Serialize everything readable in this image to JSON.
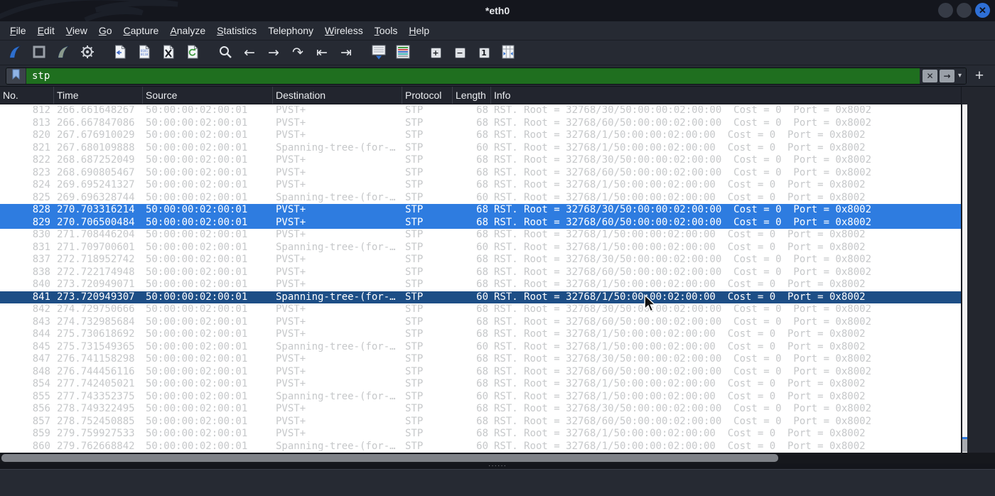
{
  "window": {
    "title": "*eth0"
  },
  "menu_bar": {
    "items": [
      {
        "label": "File",
        "mnemonic": 0
      },
      {
        "label": "Edit",
        "mnemonic": 0
      },
      {
        "label": "View",
        "mnemonic": 0
      },
      {
        "label": "Go",
        "mnemonic": 0
      },
      {
        "label": "Capture",
        "mnemonic": 0
      },
      {
        "label": "Analyze",
        "mnemonic": 0
      },
      {
        "label": "Statistics",
        "mnemonic": 0
      },
      {
        "label": "Telephony",
        "mnemonic": null
      },
      {
        "label": "Wireless",
        "mnemonic": 0
      },
      {
        "label": "Tools",
        "mnemonic": 0
      },
      {
        "label": "Help",
        "mnemonic": 0
      }
    ]
  },
  "toolbar": {
    "groups": [
      [
        {
          "name": "start-capture-button",
          "icon": "shark-fin-icon"
        },
        {
          "name": "stop-capture-button",
          "icon": "stop-square-icon"
        },
        {
          "name": "restart-capture-button",
          "icon": "shark-fin-restart-icon"
        },
        {
          "name": "capture-options-button",
          "icon": "gear-icon"
        }
      ],
      [
        {
          "name": "open-file-button",
          "icon": "open-file-icon"
        },
        {
          "name": "save-file-button",
          "icon": "save-file-icon"
        },
        {
          "name": "close-file-button",
          "icon": "close-file-icon"
        },
        {
          "name": "reload-file-button",
          "icon": "reload-file-icon"
        }
      ],
      [
        {
          "name": "find-packet-button",
          "icon": "magnifier-icon"
        },
        {
          "name": "go-back-button",
          "icon": "arrow-left-icon"
        },
        {
          "name": "go-forward-button",
          "icon": "arrow-right-icon"
        },
        {
          "name": "go-to-packet-button",
          "icon": "u-turn-arrow-icon"
        },
        {
          "name": "go-first-packet-button",
          "icon": "arrow-to-start-icon"
        },
        {
          "name": "go-last-packet-button",
          "icon": "arrow-to-end-icon"
        }
      ],
      [
        {
          "name": "auto-scroll-button",
          "icon": "auto-scroll-icon"
        },
        {
          "name": "colorize-button",
          "icon": "colorize-icon"
        }
      ],
      [
        {
          "name": "zoom-in-button",
          "icon": "plus-square-icon"
        },
        {
          "name": "zoom-out-button",
          "icon": "minus-square-icon"
        },
        {
          "name": "zoom-original-button",
          "icon": "one-square-icon"
        },
        {
          "name": "resize-columns-button",
          "icon": "resize-columns-icon"
        }
      ]
    ]
  },
  "filter_bar": {
    "value": "stp",
    "valid_bg": "#1f6f1f",
    "icons": {
      "bookmark": "bookmark-icon",
      "clear": "clear-x-icon",
      "apply": "apply-arrow-icon",
      "dropdown": "caret-down-icon",
      "add": "plus-icon"
    }
  },
  "splitter": {
    "handle_dots": "······"
  },
  "packet_list": {
    "columns": [
      "No.",
      "Time",
      "Source",
      "Destination",
      "Protocol",
      "Length",
      "Info"
    ],
    "rows": [
      {
        "no": "812",
        "time": "266.661648267",
        "source": "50:00:00:02:00:01",
        "destination": "PVST+",
        "protocol": "STP",
        "length": "68",
        "info": "RST. Root = 32768/30/50:00:00:02:00:00  Cost = 0  Port = 0x8002",
        "state": "normal"
      },
      {
        "no": "813",
        "time": "266.667847086",
        "source": "50:00:00:02:00:01",
        "destination": "PVST+",
        "protocol": "STP",
        "length": "68",
        "info": "RST. Root = 32768/60/50:00:00:02:00:00  Cost = 0  Port = 0x8002",
        "state": "normal"
      },
      {
        "no": "820",
        "time": "267.676910029",
        "source": "50:00:00:02:00:01",
        "destination": "PVST+",
        "protocol": "STP",
        "length": "68",
        "info": "RST. Root = 32768/1/50:00:00:02:00:00  Cost = 0  Port = 0x8002",
        "state": "normal"
      },
      {
        "no": "821",
        "time": "267.680109888",
        "source": "50:00:00:02:00:01",
        "destination": "Spanning-tree-(for-…",
        "protocol": "STP",
        "length": "60",
        "info": "RST. Root = 32768/1/50:00:00:02:00:00  Cost = 0  Port = 0x8002",
        "state": "normal"
      },
      {
        "no": "822",
        "time": "268.687252049",
        "source": "50:00:00:02:00:01",
        "destination": "PVST+",
        "protocol": "STP",
        "length": "68",
        "info": "RST. Root = 32768/30/50:00:00:02:00:00  Cost = 0  Port = 0x8002",
        "state": "normal"
      },
      {
        "no": "823",
        "time": "268.690805467",
        "source": "50:00:00:02:00:01",
        "destination": "PVST+",
        "protocol": "STP",
        "length": "68",
        "info": "RST. Root = 32768/60/50:00:00:02:00:00  Cost = 0  Port = 0x8002",
        "state": "normal"
      },
      {
        "no": "824",
        "time": "269.695241327",
        "source": "50:00:00:02:00:01",
        "destination": "PVST+",
        "protocol": "STP",
        "length": "68",
        "info": "RST. Root = 32768/1/50:00:00:02:00:00  Cost = 0  Port = 0x8002",
        "state": "normal"
      },
      {
        "no": "825",
        "time": "269.696328744",
        "source": "50:00:00:02:00:01",
        "destination": "Spanning-tree-(for-…",
        "protocol": "STP",
        "length": "60",
        "info": "RST. Root = 32768/1/50:00:00:02:00:00  Cost = 0  Port = 0x8002",
        "state": "normal"
      },
      {
        "no": "828",
        "time": "270.703316214",
        "source": "50:00:00:02:00:01",
        "destination": "PVST+",
        "protocol": "STP",
        "length": "68",
        "info": "RST. Root = 32768/30/50:00:00:02:00:00  Cost = 0  Port = 0x8002",
        "state": "selected"
      },
      {
        "no": "829",
        "time": "270.706500484",
        "source": "50:00:00:02:00:01",
        "destination": "PVST+",
        "protocol": "STP",
        "length": "68",
        "info": "RST. Root = 32768/60/50:00:00:02:00:00  Cost = 0  Port = 0x8002",
        "state": "selected"
      },
      {
        "no": "830",
        "time": "271.708446204",
        "source": "50:00:00:02:00:01",
        "destination": "PVST+",
        "protocol": "STP",
        "length": "68",
        "info": "RST. Root = 32768/1/50:00:00:02:00:00  Cost = 0  Port = 0x8002",
        "state": "normal"
      },
      {
        "no": "831",
        "time": "271.709700601",
        "source": "50:00:00:02:00:01",
        "destination": "Spanning-tree-(for-…",
        "protocol": "STP",
        "length": "60",
        "info": "RST. Root = 32768/1/50:00:00:02:00:00  Cost = 0  Port = 0x8002",
        "state": "normal"
      },
      {
        "no": "837",
        "time": "272.718952742",
        "source": "50:00:00:02:00:01",
        "destination": "PVST+",
        "protocol": "STP",
        "length": "68",
        "info": "RST. Root = 32768/30/50:00:00:02:00:00  Cost = 0  Port = 0x8002",
        "state": "normal"
      },
      {
        "no": "838",
        "time": "272.722174948",
        "source": "50:00:00:02:00:01",
        "destination": "PVST+",
        "protocol": "STP",
        "length": "68",
        "info": "RST. Root = 32768/60/50:00:00:02:00:00  Cost = 0  Port = 0x8002",
        "state": "normal"
      },
      {
        "no": "840",
        "time": "273.720949071",
        "source": "50:00:00:02:00:01",
        "destination": "PVST+",
        "protocol": "STP",
        "length": "68",
        "info": "RST. Root = 32768/1/50:00:00:02:00:00  Cost = 0  Port = 0x8002",
        "state": "normal"
      },
      {
        "no": "841",
        "time": "273.720949307",
        "source": "50:00:00:02:00:01",
        "destination": "Spanning-tree-(for-…",
        "protocol": "STP",
        "length": "60",
        "info": "RST. Root = 32768/1/50:00:00:02:00:00  Cost = 0  Port = 0x8002",
        "state": "focused"
      },
      {
        "no": "842",
        "time": "274.729750666",
        "source": "50:00:00:02:00:01",
        "destination": "PVST+",
        "protocol": "STP",
        "length": "68",
        "info": "RST. Root = 32768/30/50:00:00:02:00:00  Cost = 0  Port = 0x8002",
        "state": "normal"
      },
      {
        "no": "843",
        "time": "274.732985684",
        "source": "50:00:00:02:00:01",
        "destination": "PVST+",
        "protocol": "STP",
        "length": "68",
        "info": "RST. Root = 32768/60/50:00:00:02:00:00  Cost = 0  Port = 0x8002",
        "state": "normal"
      },
      {
        "no": "844",
        "time": "275.730618692",
        "source": "50:00:00:02:00:01",
        "destination": "PVST+",
        "protocol": "STP",
        "length": "68",
        "info": "RST. Root = 32768/1/50:00:00:02:00:00  Cost = 0  Port = 0x8002",
        "state": "normal"
      },
      {
        "no": "845",
        "time": "275.731549365",
        "source": "50:00:00:02:00:01",
        "destination": "Spanning-tree-(for-…",
        "protocol": "STP",
        "length": "60",
        "info": "RST. Root = 32768/1/50:00:00:02:00:00  Cost = 0  Port = 0x8002",
        "state": "normal"
      },
      {
        "no": "847",
        "time": "276.741158298",
        "source": "50:00:00:02:00:01",
        "destination": "PVST+",
        "protocol": "STP",
        "length": "68",
        "info": "RST. Root = 32768/30/50:00:00:02:00:00  Cost = 0  Port = 0x8002",
        "state": "normal"
      },
      {
        "no": "848",
        "time": "276.744456116",
        "source": "50:00:00:02:00:01",
        "destination": "PVST+",
        "protocol": "STP",
        "length": "68",
        "info": "RST. Root = 32768/60/50:00:00:02:00:00  Cost = 0  Port = 0x8002",
        "state": "normal"
      },
      {
        "no": "854",
        "time": "277.742405021",
        "source": "50:00:00:02:00:01",
        "destination": "PVST+",
        "protocol": "STP",
        "length": "68",
        "info": "RST. Root = 32768/1/50:00:00:02:00:00  Cost = 0  Port = 0x8002",
        "state": "normal"
      },
      {
        "no": "855",
        "time": "277.743352375",
        "source": "50:00:00:02:00:01",
        "destination": "Spanning-tree-(for-…",
        "protocol": "STP",
        "length": "60",
        "info": "RST. Root = 32768/1/50:00:00:02:00:00  Cost = 0  Port = 0x8002",
        "state": "normal"
      },
      {
        "no": "856",
        "time": "278.749322495",
        "source": "50:00:00:02:00:01",
        "destination": "PVST+",
        "protocol": "STP",
        "length": "68",
        "info": "RST. Root = 32768/30/50:00:00:02:00:00  Cost = 0  Port = 0x8002",
        "state": "normal"
      },
      {
        "no": "857",
        "time": "278.752450885",
        "source": "50:00:00:02:00:01",
        "destination": "PVST+",
        "protocol": "STP",
        "length": "68",
        "info": "RST. Root = 32768/60/50:00:00:02:00:00  Cost = 0  Port = 0x8002",
        "state": "normal"
      },
      {
        "no": "859",
        "time": "279.759927533",
        "source": "50:00:00:02:00:01",
        "destination": "PVST+",
        "protocol": "STP",
        "length": "68",
        "info": "RST. Root = 32768/1/50:00:00:02:00:00  Cost = 0  Port = 0x8002",
        "state": "normal"
      },
      {
        "no": "860",
        "time": "279.762668842",
        "source": "50:00:00:02:00:01",
        "destination": "Spanning-tree-(for-…",
        "protocol": "STP",
        "length": "60",
        "info": "RST. Root = 32768/1/50:00:00:02:00:00  Cost = 0  Port = 0x8002",
        "state": "normal"
      }
    ]
  },
  "colors": {
    "selected_row_bg": "#2e7ce0",
    "focused_row_bg": "#1d4e86",
    "row_text": "#c6c8ca",
    "filter_valid_bg": "#1f6f1f",
    "accent_blue": "#2e6fd6"
  }
}
